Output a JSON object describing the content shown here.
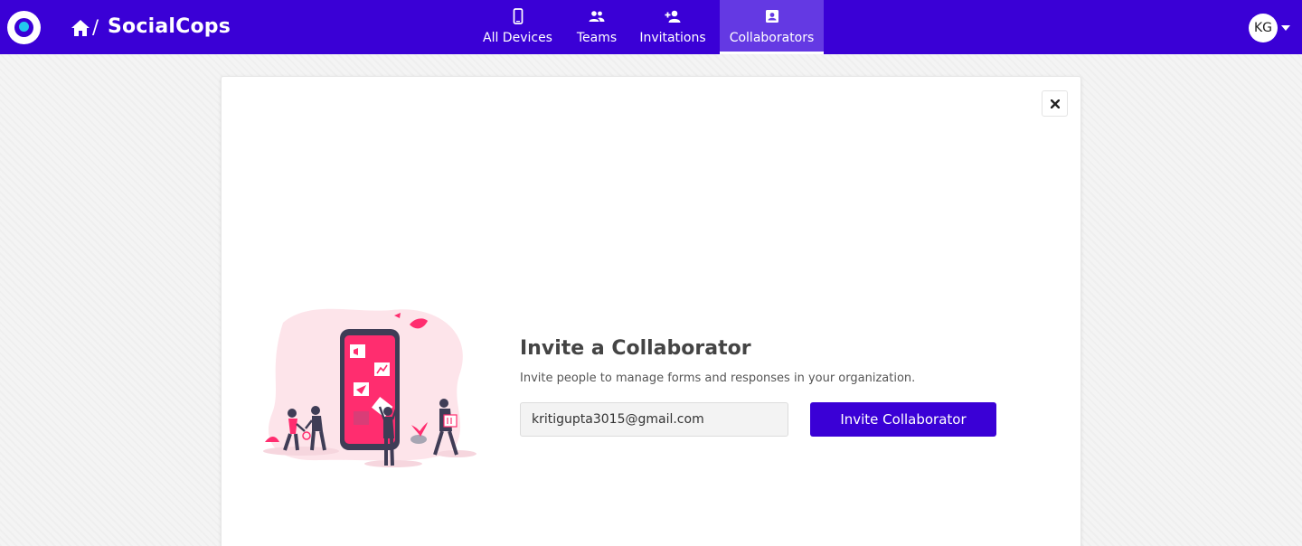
{
  "brand": {
    "name": "SocialCops",
    "separator": "/",
    "logo_icon": "socialcops-logo",
    "home_icon": "home-icon"
  },
  "nav": {
    "tabs": [
      {
        "label": "All Devices",
        "icon": "smartphone-icon",
        "active": false
      },
      {
        "label": "Teams",
        "icon": "people-icon",
        "active": false
      },
      {
        "label": "Invitations",
        "icon": "person-add-icon",
        "active": false
      },
      {
        "label": "Collaborators",
        "icon": "contact-card-icon",
        "active": true
      }
    ]
  },
  "user": {
    "initials": "KG",
    "menu_icon": "caret-down-icon"
  },
  "dialog": {
    "close_icon": "close-icon",
    "illustration": "people-around-phone-illustration",
    "title": "Invite a Collaborator",
    "description": "Invite people to manage forms and responses in your organization.",
    "email_value": "kritigupta3015@gmail.com",
    "invite_button_label": "Invite Collaborator"
  },
  "colors": {
    "primary": "#3a00d6",
    "active_tab": "#6439e3",
    "accent": "#ff2d6f",
    "logo_core": "#22c8ee"
  }
}
